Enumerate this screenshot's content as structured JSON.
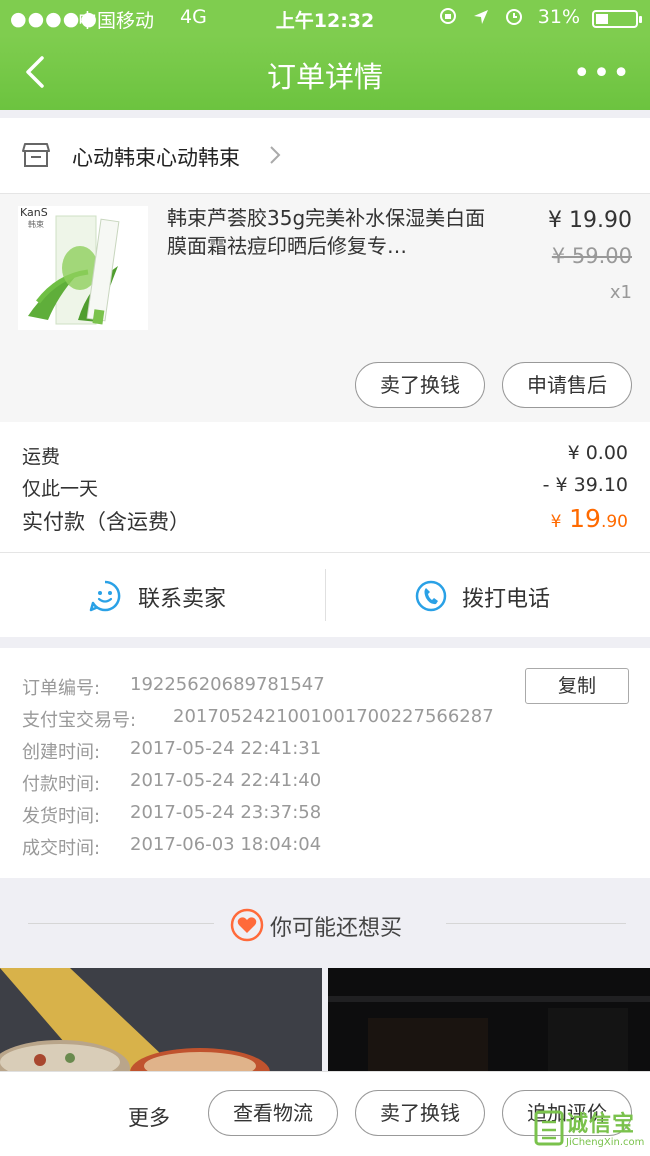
{
  "status_bar": {
    "signal": "●●●●●",
    "carrier": "中国移动",
    "network": "4G",
    "time": "上午12:32",
    "battery": "31%",
    "indicators": [
      "rotation-lock-icon",
      "location-icon",
      "alarm-icon"
    ]
  },
  "nav": {
    "title": "订单详情",
    "more": "•••"
  },
  "shop": {
    "name": "心动韩束心动韩束"
  },
  "product": {
    "name": "韩束芦荟胶35g完美补水保湿美白面膜面霜祛痘印晒后修复专…",
    "price": "¥ 19.90",
    "original_price": "¥ 59.00",
    "quantity": "x1",
    "thumb_brand": "KanS",
    "thumb_brand_sub": "韩束",
    "sell_label": "卖了换钱",
    "after_sale_label": "申请售后"
  },
  "fees": {
    "shipping_label": "运费",
    "shipping_value": "¥ 0.00",
    "discount_label": "仅此一天",
    "discount_value": "- ¥ 39.10",
    "paid_label": "实付款（含运费）",
    "paid_symbol": "¥",
    "paid_int": "19",
    "paid_dec": ".90"
  },
  "contact": {
    "seller_label": "联系卖家",
    "phone_label": "拨打电话"
  },
  "order_info": {
    "order_no_label": "订单编号:",
    "order_no": "19225620689781547",
    "copy_label": "复制",
    "alipay_label": "支付宝交易号:",
    "alipay_no": "2017052421001001700227566287",
    "created_label": "创建时间:",
    "created": "2017-05-24 22:41:31",
    "paid_label": "付款时间:",
    "paid": "2017-05-24 22:41:40",
    "shipped_label": "发货时间:",
    "shipped": "2017-05-24 23:37:58",
    "done_label": "成交时间:",
    "done": "2017-06-03 18:04:04"
  },
  "recommend": {
    "title": "你可能还想买"
  },
  "bottom_bar": {
    "more_label": "更多",
    "logistics_label": "查看物流",
    "sell_label": "卖了换钱",
    "review_label": "追加评价"
  },
  "watermark": {
    "text": "诚信宝",
    "sub": "JiChengXin.com"
  },
  "colors": {
    "nav_green": "#6cc33f",
    "price_orange": "#ff6a00",
    "contact_blue": "#2aa1e6"
  }
}
